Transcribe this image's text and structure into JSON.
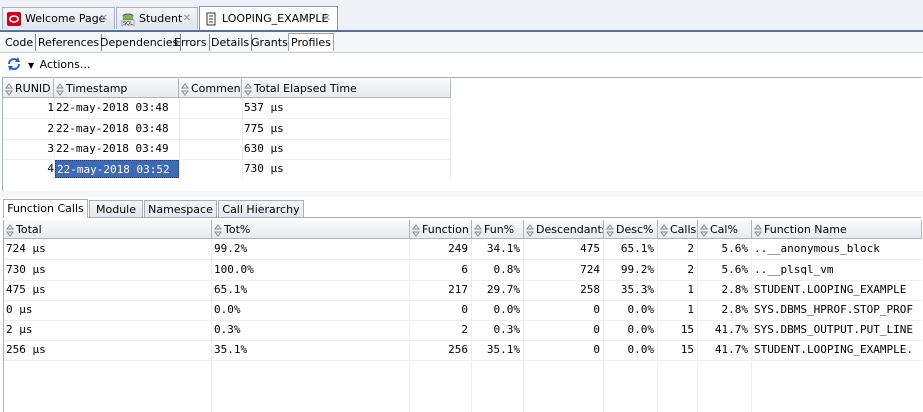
{
  "doc_tabs": [
    {
      "label": "Welcome Page",
      "close": "✕"
    },
    {
      "label": "Student",
      "close": "✕"
    },
    {
      "label": "LOOPING_EXAMPLE",
      "close": "✕"
    }
  ],
  "editor_tabs": [
    "Code",
    "References",
    "Dependencies",
    "Errors",
    "Details",
    "Grants",
    "Profiles"
  ],
  "toolbar": {
    "actions_label": "Actions..."
  },
  "runs": {
    "headers": [
      "RUNID",
      "Timestamp",
      "Comment",
      "Total Elapsed Time"
    ],
    "rows": [
      {
        "runid": "1",
        "timestamp": "22-may-2018 03:48",
        "comment": "",
        "elapsed": "537 µs"
      },
      {
        "runid": "2",
        "timestamp": "22-may-2018 03:48",
        "comment": "",
        "elapsed": "775 µs"
      },
      {
        "runid": "3",
        "timestamp": "22-may-2018 03:49",
        "comment": "",
        "elapsed": "630 µs"
      },
      {
        "runid": "4",
        "timestamp": "22-may-2018 03:52",
        "comment": "",
        "elapsed": "730 µs"
      }
    ],
    "selected_row": 3
  },
  "lower_tabs": [
    "Function Calls",
    "Module",
    "Namespace",
    "Call Hierarchy"
  ],
  "calls": {
    "headers": [
      "Total",
      "Tot%",
      "Function",
      "Fun%",
      "Descendants",
      "Desc%",
      "Calls",
      "Cal%",
      "Function Name"
    ],
    "rows": [
      {
        "total": "724 µs",
        "tot_pct": "99.2%",
        "function": "249",
        "fun_pct": "34.1%",
        "descendants": "475",
        "desc_pct": "65.1%",
        "calls": "2",
        "cal_pct": "5.6%",
        "name": "..__anonymous_block"
      },
      {
        "total": "730 µs",
        "tot_pct": "100.0%",
        "function": "6",
        "fun_pct": "0.8%",
        "descendants": "724",
        "desc_pct": "99.2%",
        "calls": "2",
        "cal_pct": "5.6%",
        "name": "..__plsql_vm"
      },
      {
        "total": "475 µs",
        "tot_pct": "65.1%",
        "function": "217",
        "fun_pct": "29.7%",
        "descendants": "258",
        "desc_pct": "35.3%",
        "calls": "1",
        "cal_pct": "2.8%",
        "name": "STUDENT.LOOPING_EXAMPLE"
      },
      {
        "total": "0 µs",
        "tot_pct": "0.0%",
        "function": "0",
        "fun_pct": "0.0%",
        "descendants": "0",
        "desc_pct": "0.0%",
        "calls": "1",
        "cal_pct": "2.8%",
        "name": "SYS.DBMS_HPROF.STOP_PROF"
      },
      {
        "total": "2 µs",
        "tot_pct": "0.3%",
        "function": "2",
        "fun_pct": "0.3%",
        "descendants": "0",
        "desc_pct": "0.0%",
        "calls": "15",
        "cal_pct": "41.7%",
        "name": "SYS.DBMS_OUTPUT.PUT_LINE"
      },
      {
        "total": "256 µs",
        "tot_pct": "35.1%",
        "function": "256",
        "fun_pct": "35.1%",
        "descendants": "0",
        "desc_pct": "0.0%",
        "calls": "15",
        "cal_pct": "41.7%",
        "name": "STUDENT.LOOPING_EXAMPLE."
      }
    ]
  }
}
